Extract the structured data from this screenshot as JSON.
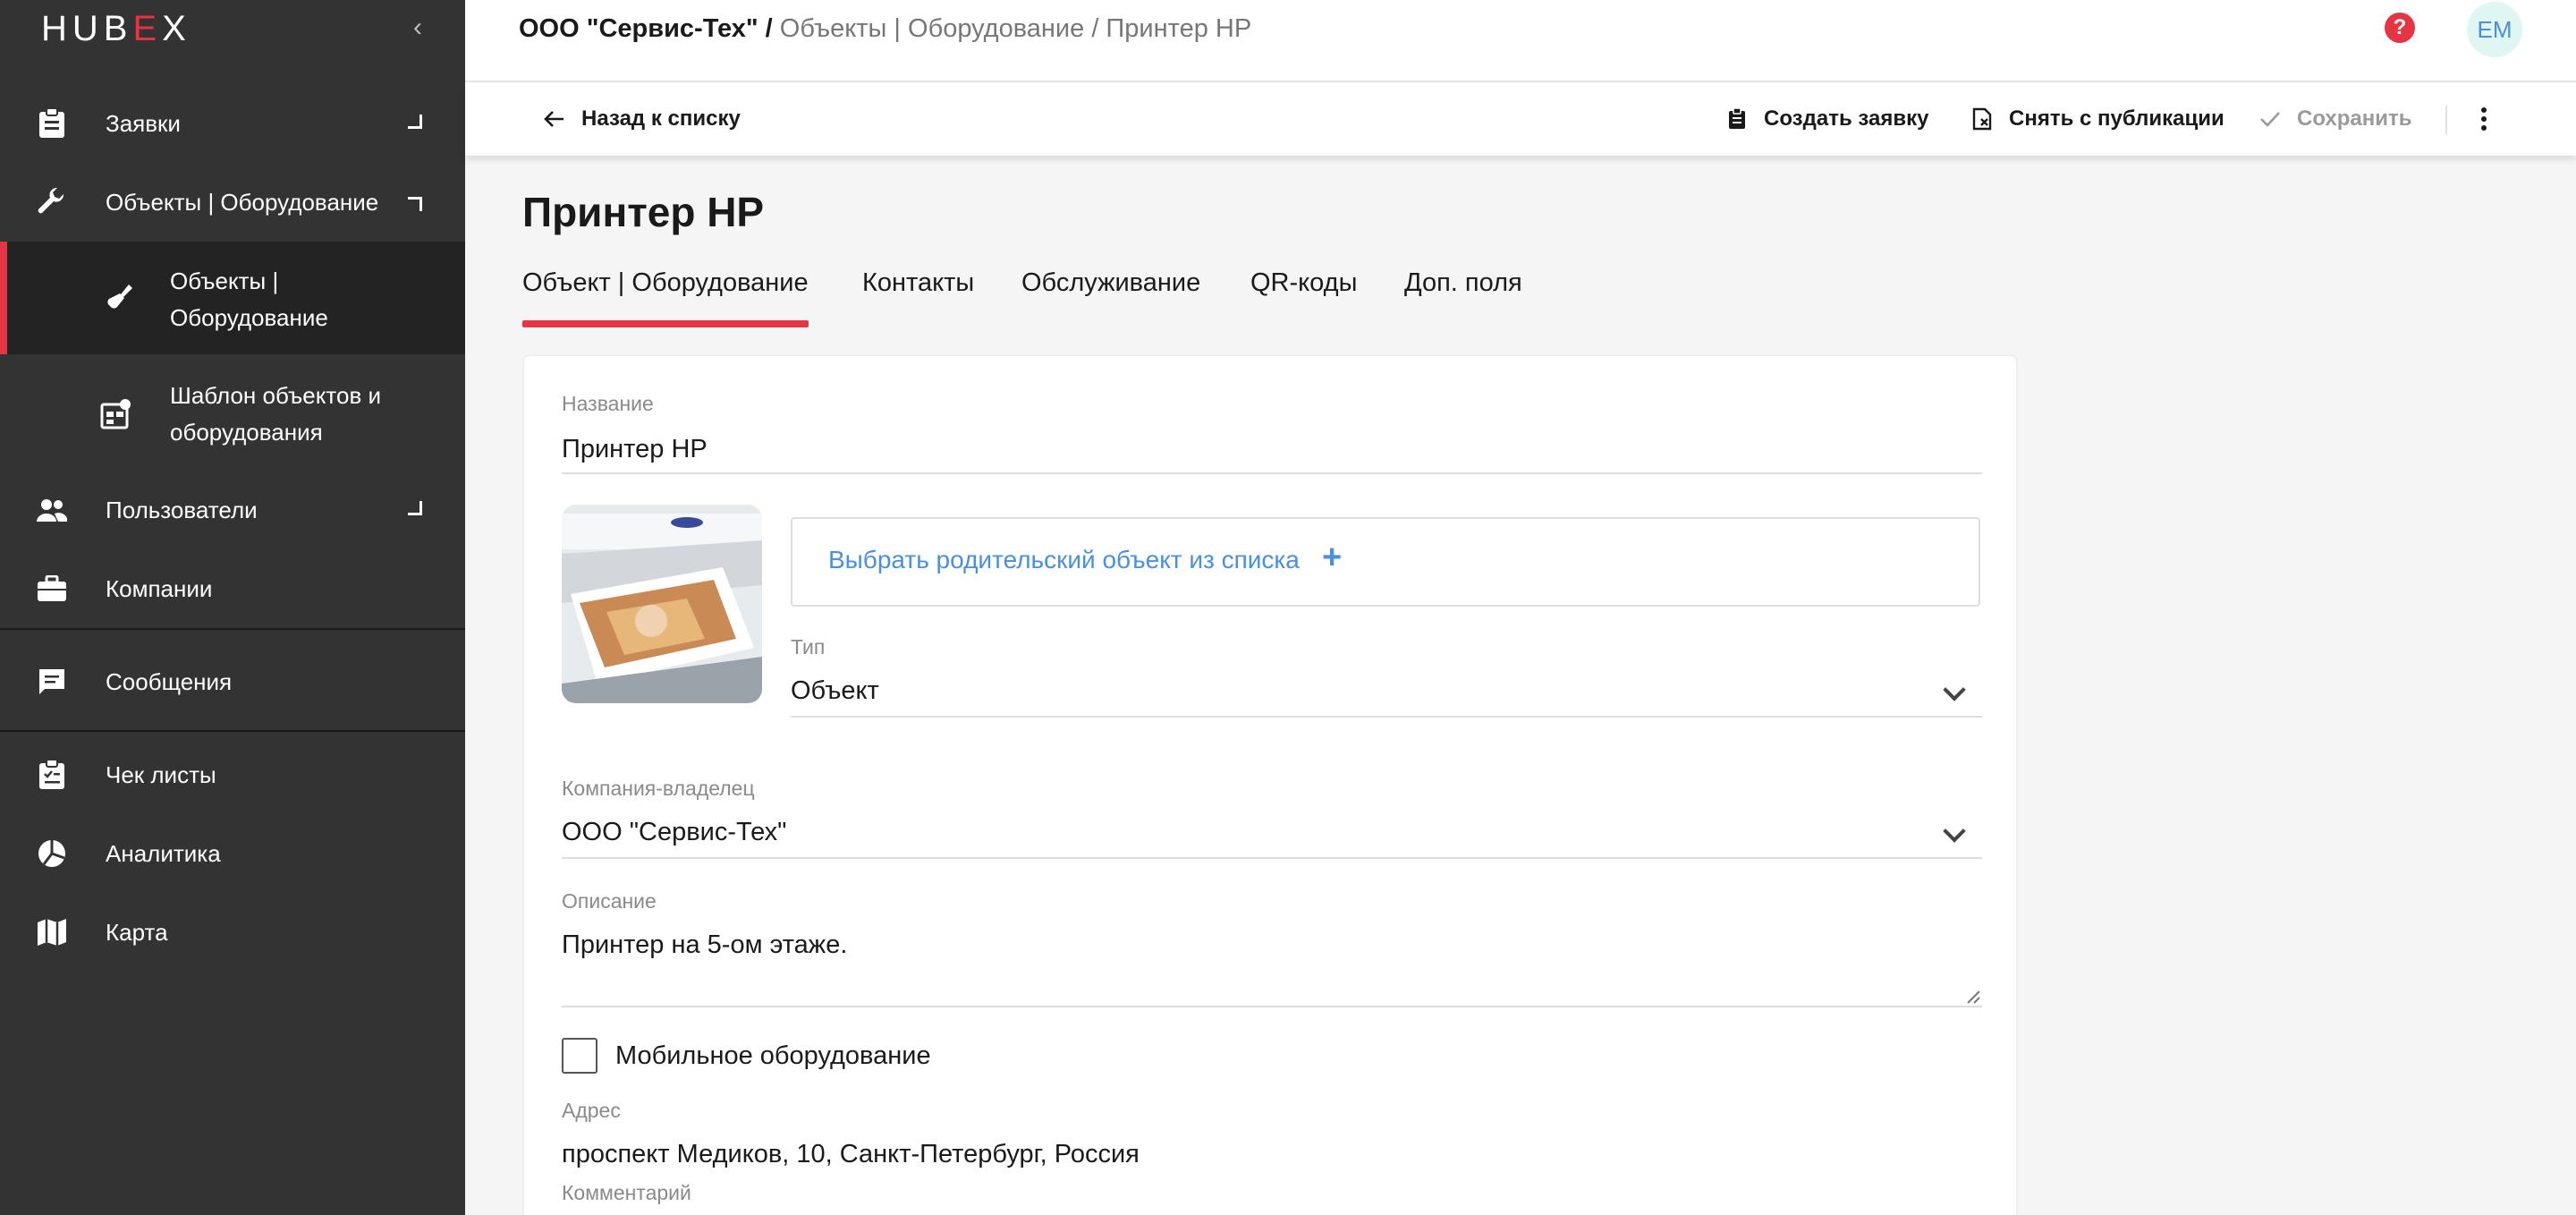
{
  "sidebar": {
    "logo_left": "HUB",
    "logo_x": "E",
    "logo_right": "X",
    "items": [
      {
        "label": "Заявки"
      },
      {
        "label": "Объекты | Оборудование"
      },
      {
        "label_line1": "Объекты |",
        "label_line2": "Оборудование"
      },
      {
        "label_line1": "Шаблон объектов и",
        "label_line2": "оборудования"
      },
      {
        "label": "Пользователи"
      },
      {
        "label": "Компании"
      },
      {
        "label": "Сообщения"
      },
      {
        "label": "Чек листы"
      },
      {
        "label": "Аналитика"
      },
      {
        "label": "Карта"
      }
    ]
  },
  "header": {
    "breadcrumb_root": "ООО \"Сервис-Тех\" /",
    "breadcrumb_rest": "Объекты | Оборудование / Принтер HP",
    "help_glyph": "?",
    "avatar_initials": "EM"
  },
  "toolbar": {
    "back_label": "Назад к списку",
    "create_label": "Создать заявку",
    "unpublish_label": "Снять с публикации",
    "save_label": "Сохранить"
  },
  "page": {
    "title": "Принтер HP",
    "tabs": [
      {
        "label": "Объект | Оборудование"
      },
      {
        "label": "Контакты"
      },
      {
        "label": "Обслуживание"
      },
      {
        "label": "QR-коды"
      },
      {
        "label": "Доп. поля"
      }
    ]
  },
  "form": {
    "name_label": "Название",
    "name_value": "Принтер HP",
    "parent_select": "Выбрать родительский объект из списка",
    "parent_plus": "+",
    "type_label": "Тип",
    "type_value": "Объект",
    "owner_label": "Компания-владелец",
    "owner_value": "ООО \"Сервис-Тех\"",
    "description_label": "Описание",
    "description_value": "Принтер на 5-ом этаже.",
    "mobile_label": "Мобильное оборудование",
    "mobile_checked": false,
    "address_label": "Адрес",
    "address_value": "проспект Медиков, 10, Санкт-Петербург, Россия",
    "comment_label": "Комментарий"
  },
  "colors": {
    "accent": "#e53444",
    "sidebar_bg": "#333333",
    "link": "#4a8fe0"
  }
}
